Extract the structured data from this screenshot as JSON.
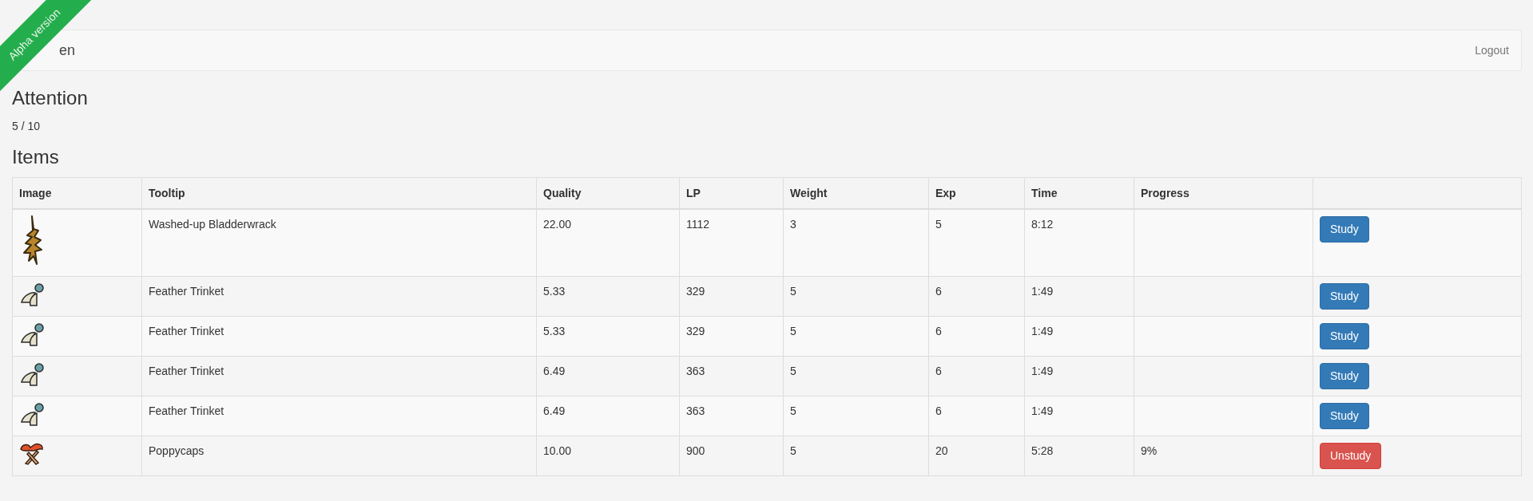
{
  "ribbon": {
    "label": "Alpha version"
  },
  "navbar": {
    "brand": "en",
    "links": [
      "Logout"
    ]
  },
  "attention": {
    "title": "Attention",
    "value": "5 / 10"
  },
  "items": {
    "title": "Items",
    "table": {
      "columns": [
        "Image",
        "Tooltip",
        "Quality",
        "LP",
        "Weight",
        "Exp",
        "Time",
        "Progress"
      ],
      "rows": [
        {
          "image": {
            "kind": "bladderwrack"
          },
          "tooltip": "Washed-up Bladderwrack",
          "quality": "22.00",
          "lp": "1112",
          "weight": "3",
          "exp": "5",
          "time": "8:12",
          "action": {
            "kind": "study",
            "label": "Study"
          }
        },
        {
          "image": {
            "kind": "feather"
          },
          "tooltip": "Feather Trinket",
          "quality": "5.33",
          "lp": "329",
          "weight": "5",
          "exp": "6",
          "time": "1:49",
          "action": {
            "kind": "study",
            "label": "Study"
          }
        },
        {
          "image": {
            "kind": "feather"
          },
          "tooltip": "Feather Trinket",
          "quality": "5.33",
          "lp": "329",
          "weight": "5",
          "exp": "6",
          "time": "1:49",
          "action": {
            "kind": "study",
            "label": "Study"
          }
        },
        {
          "image": {
            "kind": "feather"
          },
          "tooltip": "Feather Trinket",
          "quality": "6.49",
          "lp": "363",
          "weight": "5",
          "exp": "6",
          "time": "1:49",
          "action": {
            "kind": "study",
            "label": "Study"
          }
        },
        {
          "image": {
            "kind": "feather"
          },
          "tooltip": "Feather Trinket",
          "quality": "6.49",
          "lp": "363",
          "weight": "5",
          "exp": "6",
          "time": "1:49",
          "action": {
            "kind": "study",
            "label": "Study"
          }
        },
        {
          "image": {
            "kind": "poppy"
          },
          "tooltip": "Poppycaps",
          "quality": "10.00",
          "lp": "900",
          "weight": "5",
          "exp": "20",
          "time": "5:28",
          "progress": "9%",
          "action": {
            "kind": "unstudy",
            "label": "Unstudy"
          }
        }
      ]
    }
  }
}
